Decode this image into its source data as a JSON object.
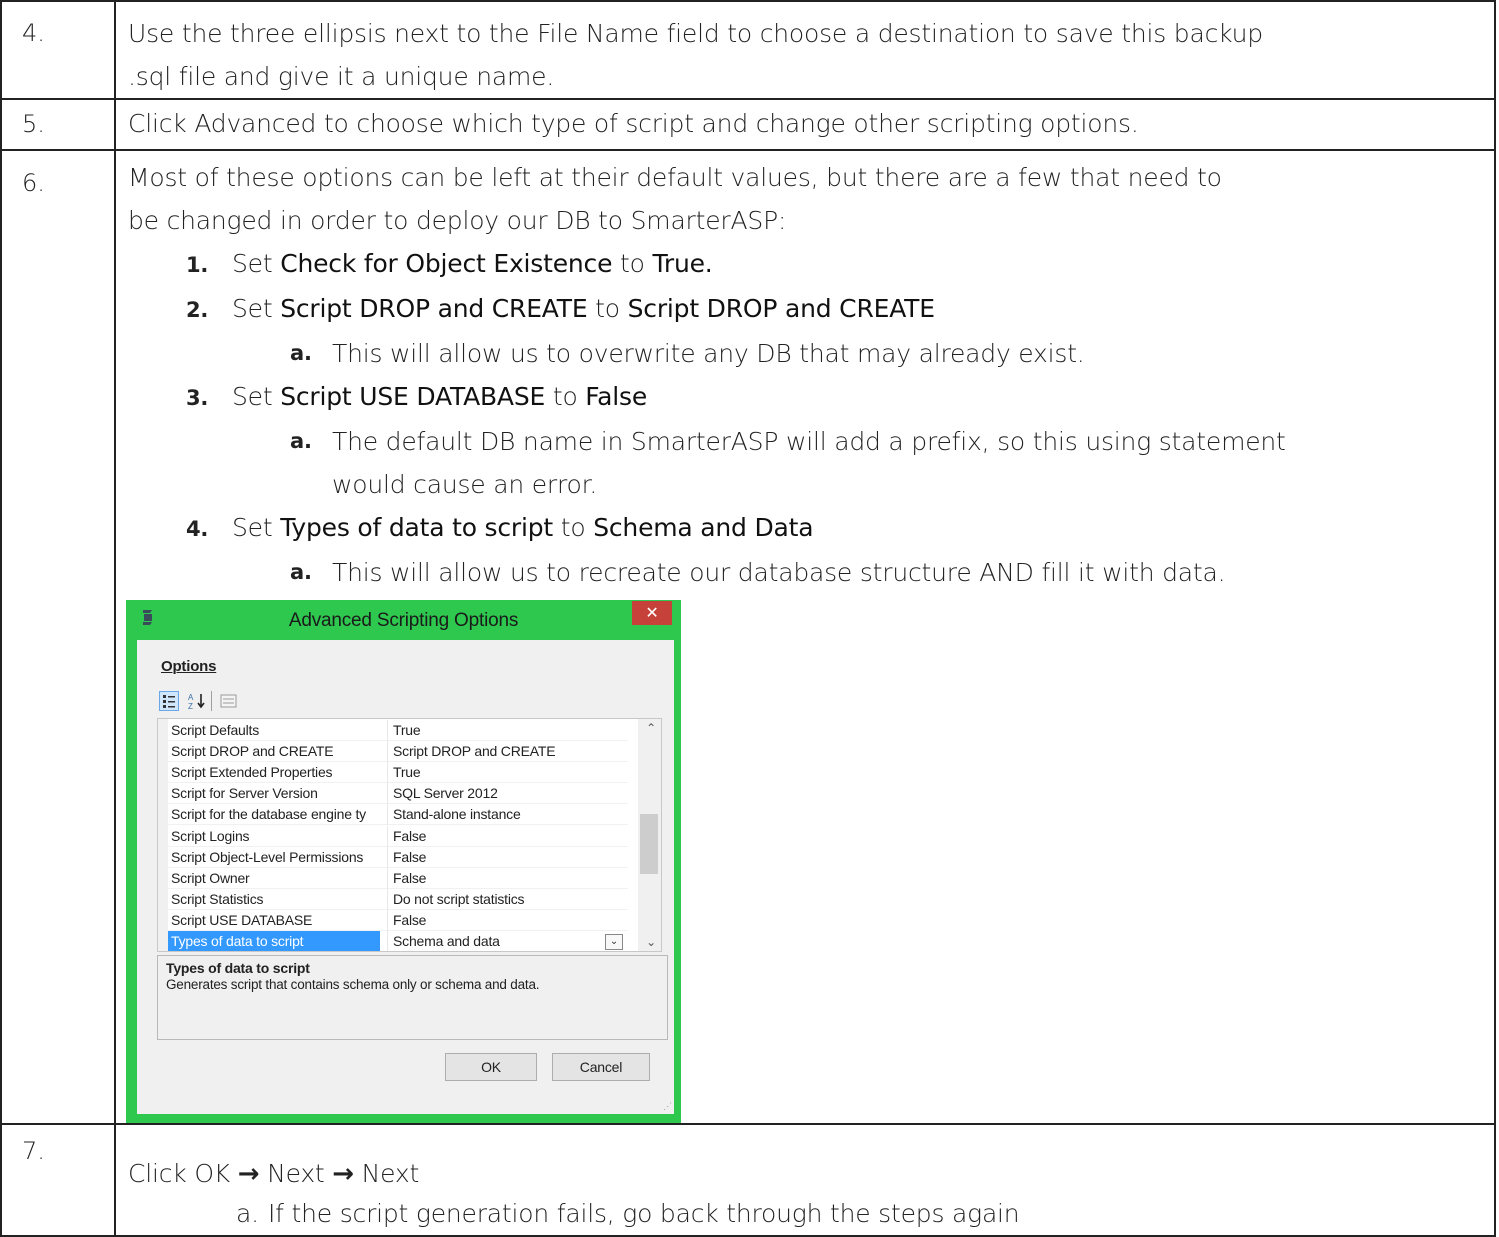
{
  "steps": [
    {
      "num": "4.",
      "text1": "Use the three ellipsis next to the File Name field to choose a destination to save this backup",
      "text2": ".sql file and give it a unique name."
    },
    {
      "num": "5.",
      "text": "Click Advanced to choose which type of script and change other scripting options."
    },
    {
      "num": "6.",
      "intro1": "Most of these options can be left at their default values, but there are a few that need to",
      "intro2": "be changed in order to deploy our DB to SmarterASP:",
      "items": [
        {
          "label": "1.",
          "prefix": "Set",
          "option": "Check for Object Existence",
          "mid": "to",
          "value": "True."
        },
        {
          "label": "2.",
          "prefix": "Set",
          "option": "Script DROP and CREATE",
          "mid": "to",
          "value": "Script DROP and CREATE",
          "sub_label": "a.",
          "sub": "This will allow us to overwrite any DB that may already exist."
        },
        {
          "label": "3.",
          "prefix": "Set",
          "option": "Script USE DATABASE",
          "mid": "to",
          "value": "False",
          "sub_label": "a.",
          "sub": "The default DB name in SmarterASP will add a prefix, so this using statement would cause an error."
        },
        {
          "label": "4.",
          "prefix": "Set",
          "option": "Types of data to script",
          "mid": "to",
          "value": "Schema and Data",
          "sub_label": "a.",
          "sub": "This will allow us to recreate our database structure AND fill it with data."
        }
      ]
    },
    {
      "num": "7.",
      "click": "Click OK",
      "arrow": "→",
      "next1": "Next",
      "next2": "Next",
      "sub_label": "a.",
      "sub": "If the script generation fails, go back through the steps again"
    }
  ],
  "dialog": {
    "title": "Advanced Scripting Options",
    "close_icon": "✕",
    "options_heading": "Options",
    "rows": [
      {
        "name": "Script Defaults",
        "value": "True"
      },
      {
        "name": "Script DROP and CREATE",
        "value": "Script DROP and CREATE"
      },
      {
        "name": "Script Extended Properties",
        "value": "True"
      },
      {
        "name": "Script for Server Version",
        "value": "SQL Server 2012"
      },
      {
        "name": "Script for the database engine ty",
        "value": "Stand-alone instance"
      },
      {
        "name": "Script Logins",
        "value": "False"
      },
      {
        "name": "Script Object-Level Permissions",
        "value": "False"
      },
      {
        "name": "Script Owner",
        "value": "False"
      },
      {
        "name": "Script Statistics",
        "value": "Do not script statistics"
      },
      {
        "name": "Script USE DATABASE",
        "value": "False"
      },
      {
        "name": "Types of data to script",
        "value": "Schema and data"
      }
    ],
    "selected_index": 10,
    "description_title": "Types of data to script",
    "description_body": "Generates script that contains schema only or schema and data.",
    "ok_label": "OK",
    "cancel_label": "Cancel"
  },
  "colors": {
    "dialog_frame": "#2ec84f",
    "close_button": "#c7413b",
    "selection": "#3399ff"
  }
}
